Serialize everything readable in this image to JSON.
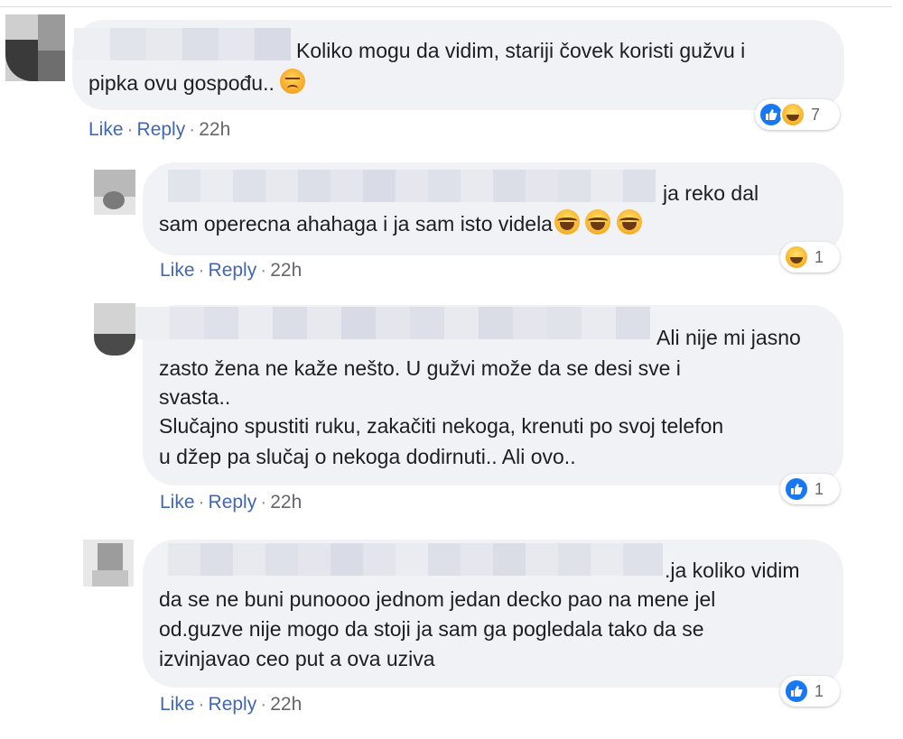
{
  "comments": [
    {
      "text": "Koliko mogu da vidim, stariji čovek koristi gužvu i",
      "text2": "pipka ovu gospođu..",
      "emoji": "angry-face-icon",
      "actions": {
        "like": "Like",
        "reply": "Reply",
        "time": "22h"
      },
      "reaction_count": "7",
      "reaction_icons": [
        "like-icon",
        "haha-icon"
      ]
    },
    {
      "text": "ja reko dal",
      "text2": "sam operecna ahahaga i ja sam isto videla",
      "emoji": "laughing-face-icon",
      "actions": {
        "like": "Like",
        "reply": "Reply",
        "time": "22h"
      },
      "reaction_count": "1",
      "reaction_icons": [
        "haha-icon"
      ]
    },
    {
      "text": "Ali nije mi jasno",
      "lines": [
        "zasto žena ne kaže nešto. U gužvi može da se desi sve i",
        "svasta..",
        "Slučajno spustiti ruku, zakačiti nekoga, krenuti po svoj telefon",
        "u džep pa slučaj o nekoga dodirnuti.. Ali ovo.."
      ],
      "actions": {
        "like": "Like",
        "reply": "Reply",
        "time": "22h"
      },
      "reaction_count": "1",
      "reaction_icons": [
        "like-icon"
      ]
    },
    {
      "text": ".ja koliko vidim",
      "lines": [
        "da se ne buni punoooo jednom jedan decko pao na mene jel",
        "od.guzve nije mogo da stoji ja sam ga pogledala tako da se",
        "izvinjavao ceo put a ova uziva"
      ],
      "actions": {
        "like": "Like",
        "reply": "Reply",
        "time": "22h"
      },
      "reaction_count": "1",
      "reaction_icons": [
        "like-icon"
      ]
    }
  ],
  "colors": {
    "bubble": "#f0f2f5",
    "link": "#4267b2",
    "like_blue": "#1877f2",
    "meta": "#65676b"
  }
}
